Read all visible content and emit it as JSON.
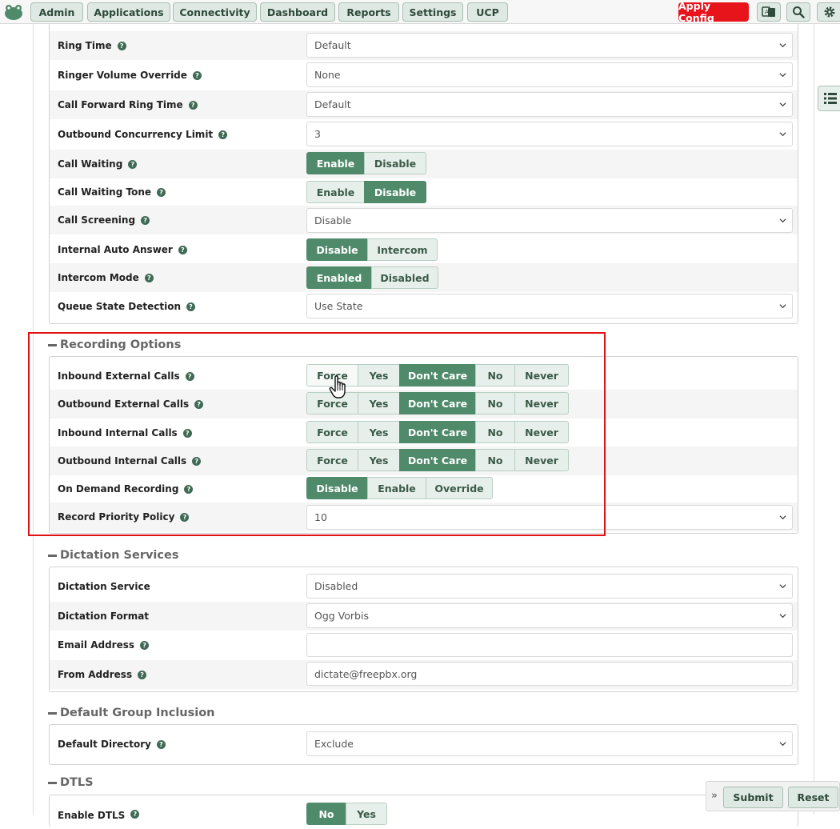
{
  "nav": {
    "items": [
      "Admin",
      "Applications",
      "Connectivity",
      "Dashboard",
      "Reports",
      "Settings",
      "UCP"
    ],
    "apply_config": "Apply Config",
    "icons": [
      "language-icon",
      "search-icon",
      "gear-icon"
    ]
  },
  "top_rows": [
    {
      "label": "Ring Time",
      "type": "select",
      "value": "Default"
    },
    {
      "label": "Ringer Volume Override",
      "type": "select",
      "value": "None"
    },
    {
      "label": "Call Forward Ring Time",
      "type": "select",
      "value": "Default"
    },
    {
      "label": "Outbound Concurrency Limit",
      "type": "select",
      "value": "3"
    },
    {
      "label": "Call Waiting",
      "type": "toggle",
      "options": [
        "Enable",
        "Disable"
      ],
      "active": 0
    },
    {
      "label": "Call Waiting Tone",
      "type": "toggle",
      "options": [
        "Enable",
        "Disable"
      ],
      "active": 1
    },
    {
      "label": "Call Screening",
      "type": "select",
      "value": "Disable"
    },
    {
      "label": "Internal Auto Answer",
      "type": "toggle",
      "options": [
        "Disable",
        "Intercom"
      ],
      "active": 0
    },
    {
      "label": "Intercom Mode",
      "type": "toggle",
      "options": [
        "Enabled",
        "Disabled"
      ],
      "active": 0
    },
    {
      "label": "Queue State Detection",
      "type": "select",
      "value": "Use State"
    }
  ],
  "recording": {
    "title": "Recording Options",
    "rows": [
      {
        "label": "Inbound External Calls",
        "options": [
          "Force",
          "Yes",
          "Don't Care",
          "No",
          "Never"
        ],
        "active": 2
      },
      {
        "label": "Outbound External Calls",
        "options": [
          "Force",
          "Yes",
          "Don't Care",
          "No",
          "Never"
        ],
        "active": 2
      },
      {
        "label": "Inbound Internal Calls",
        "options": [
          "Force",
          "Yes",
          "Don't Care",
          "No",
          "Never"
        ],
        "active": 2
      },
      {
        "label": "Outbound Internal Calls",
        "options": [
          "Force",
          "Yes",
          "Don't Care",
          "No",
          "Never"
        ],
        "active": 2
      },
      {
        "label": "On Demand Recording",
        "options": [
          "Disable",
          "Enable",
          "Override"
        ],
        "active": 0
      },
      {
        "label": "Record Priority Policy",
        "type": "select",
        "value": "10"
      }
    ]
  },
  "dictation": {
    "title": "Dictation Services",
    "rows": [
      {
        "label": "Dictation Service",
        "type": "select",
        "value": "Disabled",
        "help": false
      },
      {
        "label": "Dictation Format",
        "type": "select",
        "value": "Ogg Vorbis",
        "help": false
      },
      {
        "label": "Email Address",
        "type": "input",
        "value": "",
        "help": true
      },
      {
        "label": "From Address",
        "type": "input",
        "value": "dictate@freepbx.org",
        "help": true
      }
    ]
  },
  "group_inclusion": {
    "title": "Default Group Inclusion",
    "rows": [
      {
        "label": "Default Directory",
        "type": "select",
        "value": "Exclude"
      }
    ]
  },
  "dtls": {
    "title": "DTLS",
    "rows": [
      {
        "label": "Enable DTLS",
        "options": [
          "No",
          "Yes"
        ],
        "active": 0
      }
    ]
  },
  "footer": {
    "submit": "Submit",
    "reset": "Reset"
  }
}
